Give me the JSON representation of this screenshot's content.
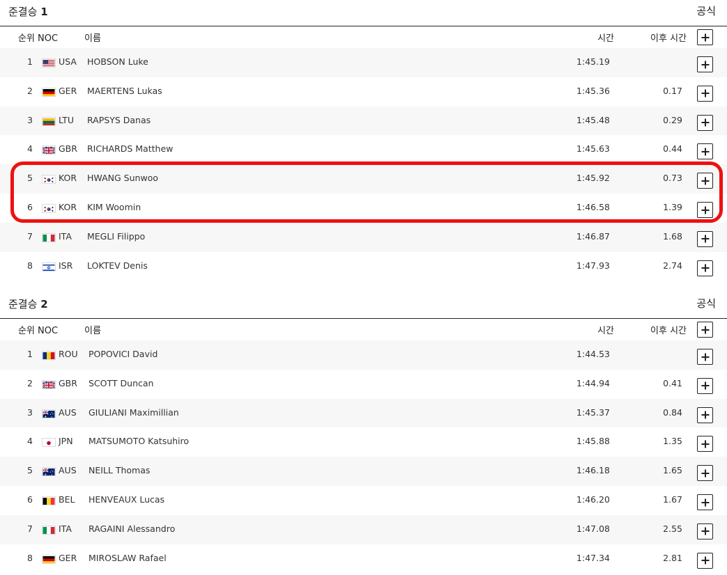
{
  "sections": [
    {
      "title": "준결승",
      "number": "1",
      "official": "공식",
      "columns": {
        "rank_noc": "순위 NOC",
        "name": "이름",
        "time": "시간",
        "behind": "이후 시간"
      },
      "rows": [
        {
          "rank": "1",
          "flag": "usa-flag",
          "noc": "USA",
          "name": "HOBSON Luke",
          "time": "1:45.19",
          "behind": ""
        },
        {
          "rank": "2",
          "flag": "ger-flag",
          "noc": "GER",
          "name": "MAERTENS Lukas",
          "time": "1:45.36",
          "behind": "0.17"
        },
        {
          "rank": "3",
          "flag": "ltu-flag",
          "noc": "LTU",
          "name": "RAPSYS Danas",
          "time": "1:45.48",
          "behind": "0.29"
        },
        {
          "rank": "4",
          "flag": "gbr-flag",
          "noc": "GBR",
          "name": "RICHARDS Matthew",
          "time": "1:45.63",
          "behind": "0.44"
        },
        {
          "rank": "5",
          "flag": "kor-flag",
          "noc": "KOR",
          "name": "HWANG Sunwoo",
          "time": "1:45.92",
          "behind": "0.73"
        },
        {
          "rank": "6",
          "flag": "kor-flag",
          "noc": "KOR",
          "name": "KIM Woomin",
          "time": "1:46.58",
          "behind": "1.39"
        },
        {
          "rank": "7",
          "flag": "ita-flag",
          "noc": "ITA",
          "name": "MEGLI Filippo",
          "time": "1:46.87",
          "behind": "1.68"
        },
        {
          "rank": "8",
          "flag": "isr-flag",
          "noc": "ISR",
          "name": "LOKTEV Denis",
          "time": "1:47.93",
          "behind": "2.74"
        }
      ]
    },
    {
      "title": "준결승",
      "number": "2",
      "official": "공식",
      "columns": {
        "rank_noc": "순위 NOC",
        "name": "이름",
        "time": "시간",
        "behind": "이후 시간"
      },
      "rows": [
        {
          "rank": "1",
          "flag": "rou-flag",
          "noc": "ROU",
          "name": "POPOVICI David",
          "time": "1:44.53",
          "behind": ""
        },
        {
          "rank": "2",
          "flag": "gbr-flag",
          "noc": "GBR",
          "name": "SCOTT Duncan",
          "time": "1:44.94",
          "behind": "0.41"
        },
        {
          "rank": "3",
          "flag": "aus-flag",
          "noc": "AUS",
          "name": "GIULIANI Maximillian",
          "time": "1:45.37",
          "behind": "0.84"
        },
        {
          "rank": "4",
          "flag": "jpn-flag",
          "noc": "JPN",
          "name": "MATSUMOTO Katsuhiro",
          "time": "1:45.88",
          "behind": "1.35"
        },
        {
          "rank": "5",
          "flag": "aus-flag",
          "noc": "AUS",
          "name": "NEILL Thomas",
          "time": "1:46.18",
          "behind": "1.65"
        },
        {
          "rank": "6",
          "flag": "bel-flag",
          "noc": "BEL",
          "name": "HENVEAUX Lucas",
          "time": "1:46.20",
          "behind": "1.67"
        },
        {
          "rank": "7",
          "flag": "ita-flag",
          "noc": "ITA",
          "name": "RAGAINI Alessandro",
          "time": "1:47.08",
          "behind": "2.55"
        },
        {
          "rank": "8",
          "flag": "ger-flag",
          "noc": "GER",
          "name": "MIROSLAW Rafael",
          "time": "1:47.34",
          "behind": "2.81"
        }
      ]
    }
  ],
  "colors": {
    "highlight_border": "#ee1111",
    "row_alt_bg": "#f7f7f7"
  }
}
